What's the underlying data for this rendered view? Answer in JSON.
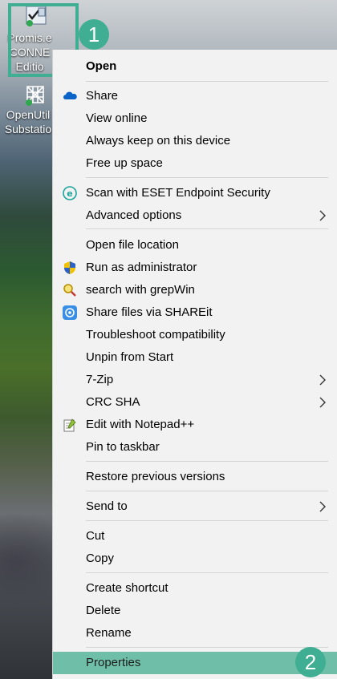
{
  "desktop": {
    "icons": [
      {
        "label_lines": [
          "Promis.e",
          "CONNE",
          "Editio"
        ]
      },
      {
        "label_lines": [
          "OpenUtil",
          "Substatio"
        ]
      }
    ]
  },
  "annotations": {
    "badge1": "1",
    "badge2": "2"
  },
  "menu": {
    "open": "Open",
    "share": "Share",
    "view_online": "View online",
    "always_keep": "Always keep on this device",
    "free_up": "Free up space",
    "scan_eset": "Scan with ESET Endpoint Security",
    "advanced": "Advanced options",
    "open_location": "Open file location",
    "run_admin": "Run as administrator",
    "grepwin": "search with grepWin",
    "shareit": "Share files via SHAREit",
    "troubleshoot": "Troubleshoot compatibility",
    "unpin": "Unpin from Start",
    "zip": "7-Zip",
    "crc": "CRC SHA",
    "notepad": "Edit with Notepad++",
    "pin_taskbar": "Pin to taskbar",
    "restore": "Restore previous versions",
    "send_to": "Send to",
    "cut": "Cut",
    "copy": "Copy",
    "create_shortcut": "Create shortcut",
    "delete": "Delete",
    "rename": "Rename",
    "properties": "Properties"
  },
  "colors": {
    "highlight": "#3fae92",
    "menu_bg": "#f2f2f2"
  }
}
